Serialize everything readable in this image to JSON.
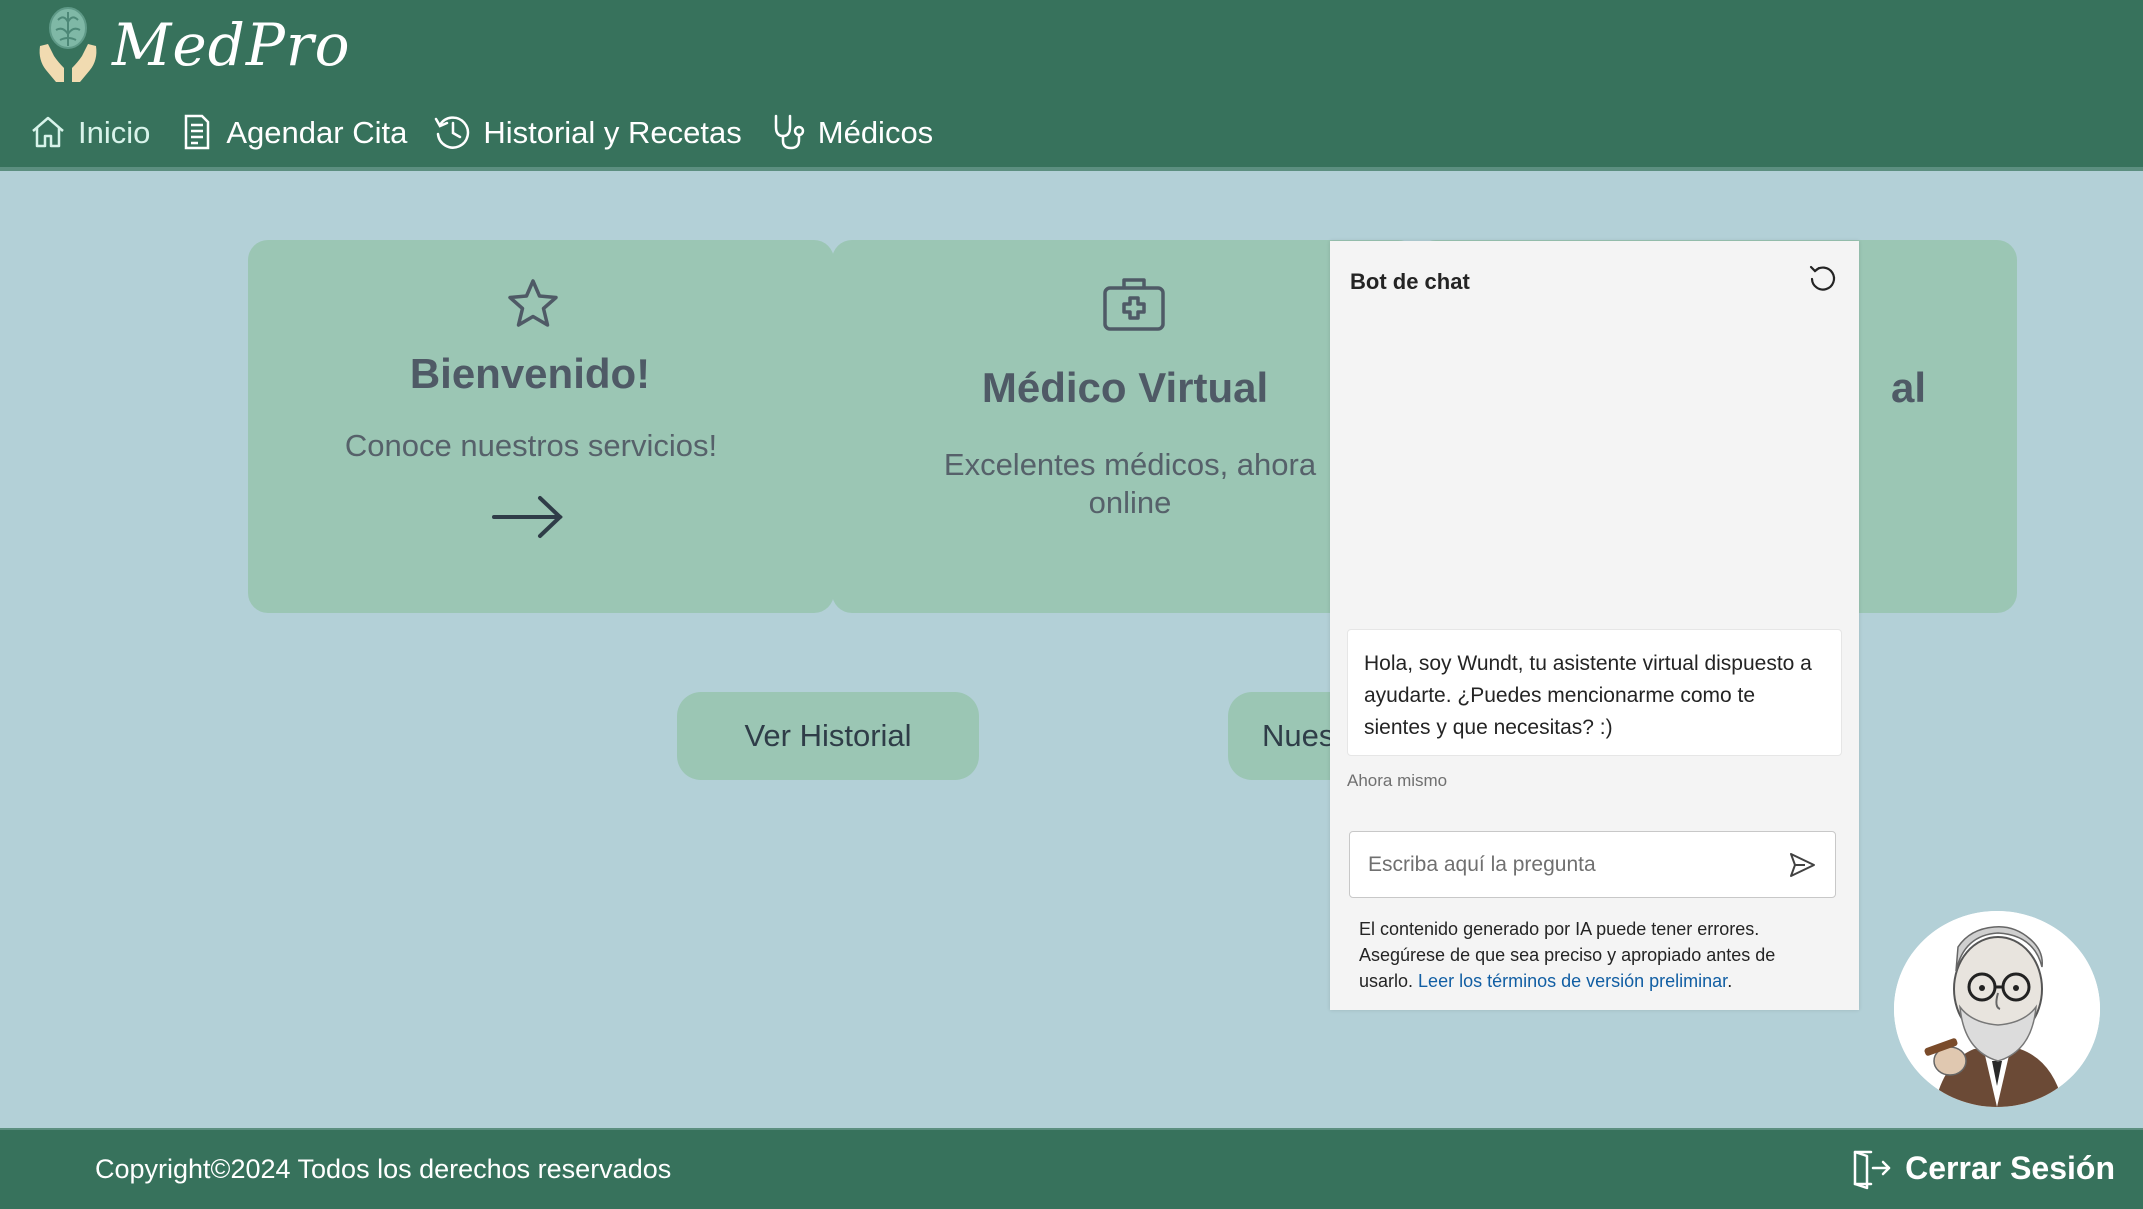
{
  "header": {
    "brand": "MedPro",
    "nav": [
      {
        "label": "Inicio",
        "icon": "home-icon",
        "active": true
      },
      {
        "label": "Agendar Cita",
        "icon": "document-icon"
      },
      {
        "label": "Historial y Recetas",
        "icon": "history-icon"
      },
      {
        "label": "Médicos",
        "icon": "stethoscope-icon"
      }
    ]
  },
  "cards": [
    {
      "icon": "star-icon",
      "title": "Bienvenido!",
      "text": "Conoce nuestros servicios!",
      "link_icon": "arrow-right-icon"
    },
    {
      "icon": "medical-kit-icon",
      "title": "Médico Virtual",
      "text": "Excelentes médicos, ahora online"
    },
    {
      "title_visible": "al"
    }
  ],
  "buttons": {
    "historial": "Ver Historial",
    "second_partial": "Nues"
  },
  "chat": {
    "title": "Bot de chat",
    "message": "Hola, soy Wundt, tu asistente virtual dispuesto a ayudarte. ¿Puedes mencionarme como te sientes y que necesitas? :)",
    "time": "Ahora mismo",
    "input_placeholder": "Escriba aquí la pregunta",
    "disclaimer_text": "El contenido generado por IA puede tener errores. Asegúrese de que sea preciso y apropiado antes de usarlo.",
    "disclaimer_link": "Leer los términos de versión preliminar",
    "disclaimer_end": "."
  },
  "footer": {
    "copyright": "Copyright©2024 Todos los derechos reservados",
    "logout": "Cerrar Sesión"
  },
  "colors": {
    "header_bg": "#37725c",
    "page_bg": "#b3d0d7",
    "card_bg": "#9bc6b4",
    "link": "#115ea3"
  }
}
